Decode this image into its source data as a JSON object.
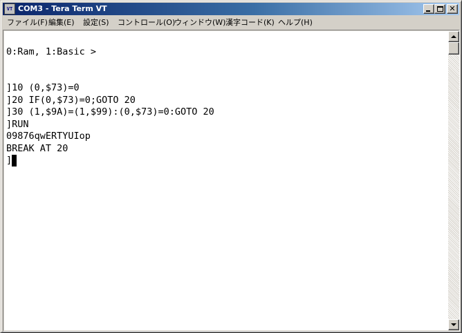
{
  "window": {
    "title": "COM3 - Tera Term VT",
    "icon_name": "teraterm-vt-icon",
    "icon_glyph": "VT",
    "minimize_glyph": "",
    "maximize_glyph": "",
    "close_glyph": "✕"
  },
  "menubar": {
    "items": [
      {
        "label": "ファイル(F)"
      },
      {
        "label": "編集(E)"
      },
      {
        "label": "設定(S)"
      },
      {
        "label": "コントロール(O)"
      },
      {
        "label": "ウィンドウ(W)"
      },
      {
        "label": "漢字コード(K)"
      },
      {
        "label": "ヘルプ(H)"
      }
    ]
  },
  "terminal": {
    "lines": [
      "",
      "0:Ram, 1:Basic >",
      "",
      "",
      "]10 (0,$73)=0",
      "]20 IF(0,$73)=0;GOTO 20",
      "]30 (1,$9A)=(1,$99):(0,$73)=0:GOTO 20",
      "]RUN",
      "09876qwERTYUIop",
      "BREAK AT 20",
      "]"
    ],
    "background": "#ffffff",
    "foreground": "#000000"
  },
  "scrollbar": {
    "up_icon": "scroll-up-arrow-icon",
    "down_icon": "scroll-down-arrow-icon"
  },
  "colors": {
    "title_active_start": "#0a246a",
    "title_active_end": "#a6caf0",
    "chrome": "#d4d0c8"
  }
}
